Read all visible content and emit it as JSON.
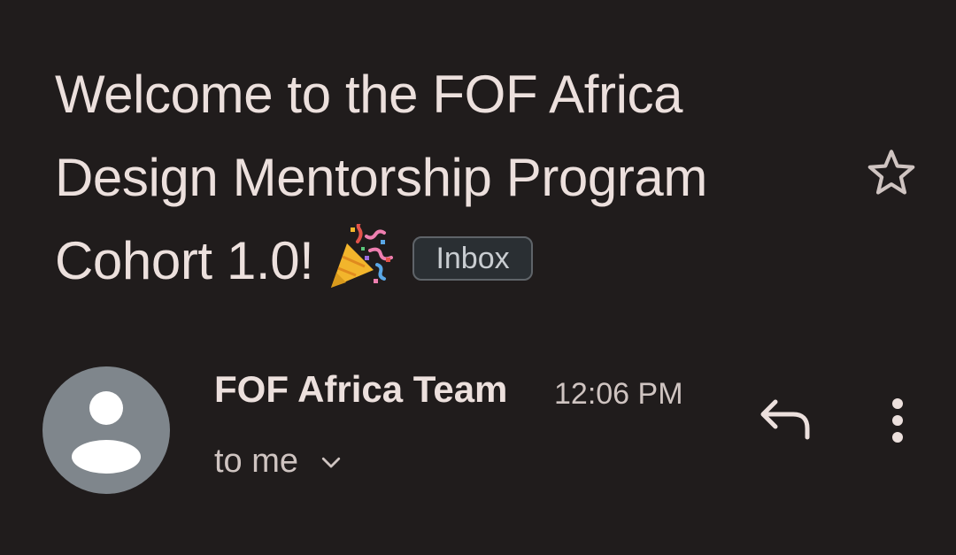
{
  "email": {
    "subject_lines": [
      "Welcome to the FOF Africa",
      "Design Mentorship Program",
      "Cohort 1.0!"
    ],
    "label_chip": "Inbox",
    "sender_name": "FOF Africa Team",
    "time": "12:06 PM",
    "recipient": "to me"
  },
  "icons": {
    "party": "party-popper-icon",
    "star": "star-outline-icon",
    "avatar": "person-icon",
    "expand": "chevron-down-icon",
    "reply": "reply-icon",
    "more": "more-vert-icon"
  },
  "colors": {
    "background": "#201c1c",
    "text_primary": "#ece0dd",
    "text_secondary": "#cfc4c1",
    "chip_border": "#5f6469",
    "avatar_bg": "#7f868c"
  }
}
